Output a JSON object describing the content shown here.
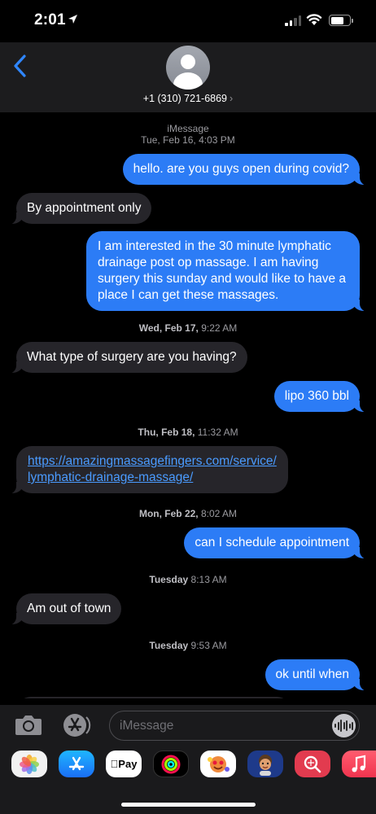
{
  "status_bar": {
    "time": "2:01"
  },
  "header": {
    "contact": "+1 (310) 721-6869",
    "chevron": "›"
  },
  "thread": {
    "service": "iMessage",
    "stamps": [
      {
        "day": "Tue, Feb 16,",
        "time": "4:03 PM"
      },
      {
        "day": "Wed, Feb 17,",
        "time": "9:22 AM"
      },
      {
        "day": "Thu, Feb 18,",
        "time": "11:32 AM"
      },
      {
        "day": "Mon, Feb 22,",
        "time": "8:02 AM"
      },
      {
        "day": "Tuesday",
        "time": "8:13 AM"
      },
      {
        "day": "Tuesday",
        "time": "9:53 AM"
      }
    ],
    "messages": [
      {
        "from": "me",
        "text": "hello. are you guys open during covid?"
      },
      {
        "from": "them",
        "text": "By appointment only"
      },
      {
        "from": "me",
        "lines": [
          "I am interested in the 30 minute lymphatic",
          "drainage post op massage. I am having",
          "surgery this sunday and would like to have a",
          "place I can get these massages."
        ]
      },
      {
        "from": "them",
        "text": "What type of surgery are you having?"
      },
      {
        "from": "me",
        "text": "lipo 360 bbl"
      },
      {
        "from": "them",
        "link_lines": [
          "https://amazingmassagefingers.com/service/",
          "lymphatic-drainage-massage/"
        ]
      },
      {
        "from": "me",
        "text": "can I schedule appointment"
      },
      {
        "from": "them",
        "text": "Am out of town"
      },
      {
        "from": "me",
        "text": "ok until when"
      }
    ]
  },
  "input": {
    "placeholder": "iMessage"
  },
  "drawer": {
    "apps": [
      {
        "name": "Photos",
        "icon": "photos-icon"
      },
      {
        "name": "App Store",
        "icon": "app-store-icon"
      },
      {
        "name": "Apple Pay",
        "label": "Pay",
        "icon": "apple-pay-icon"
      },
      {
        "name": "Activity",
        "icon": "activity-icon"
      },
      {
        "name": "Memoji Stickers",
        "icon": "memoji-stickers-icon"
      },
      {
        "name": "Memoji",
        "icon": "memoji-icon"
      },
      {
        "name": "Search",
        "icon": "web-search-icon"
      },
      {
        "name": "Music",
        "icon": "music-icon"
      }
    ]
  },
  "colors": {
    "outgoing_bubble": "#2c7cf6",
    "incoming_bubble": "#26252a",
    "link": "#4a9bff",
    "accent": "#2f86ff"
  }
}
